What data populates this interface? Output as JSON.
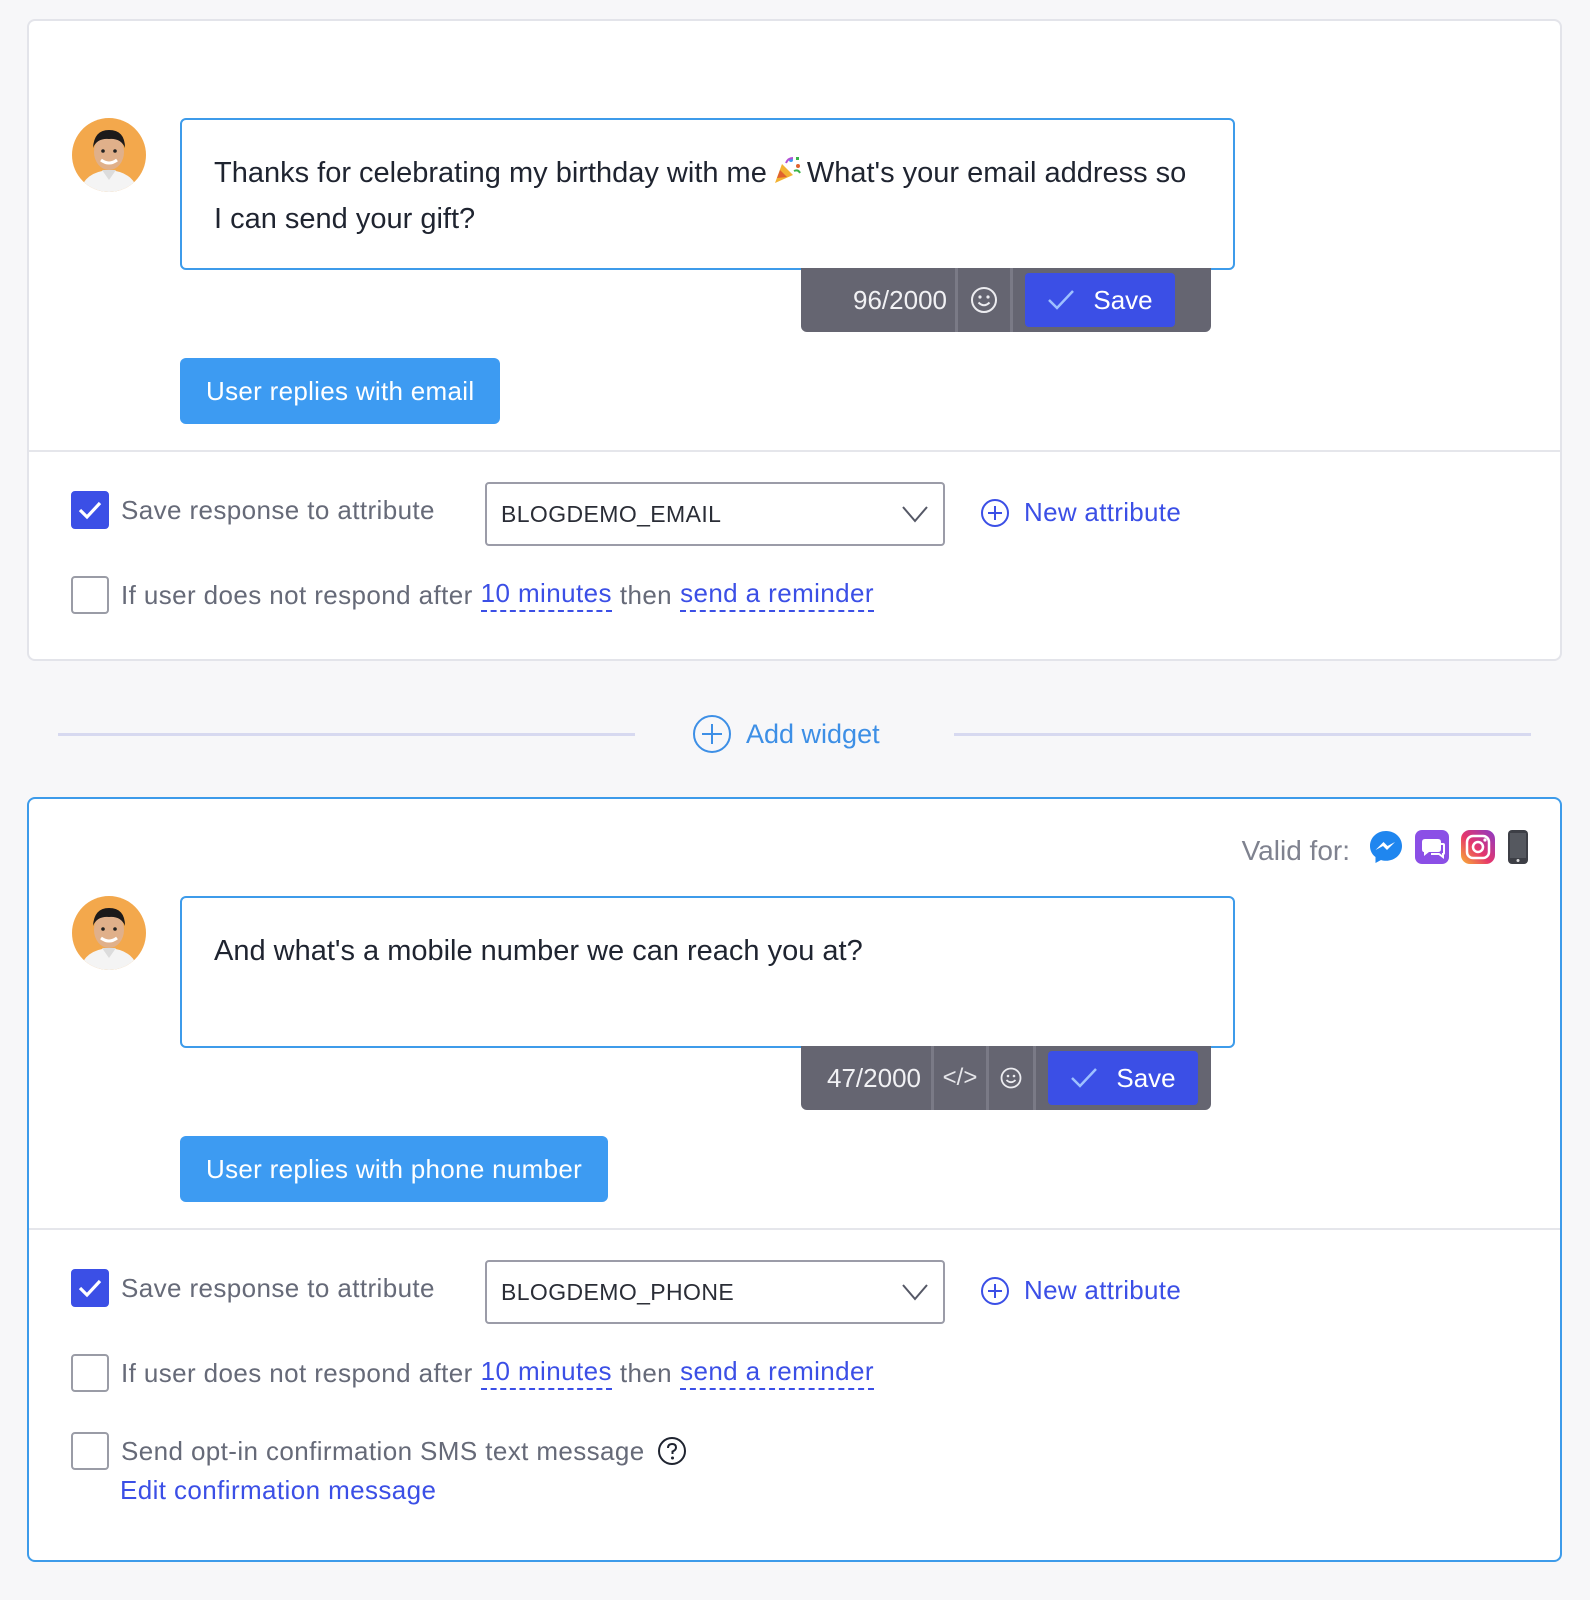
{
  "widget1": {
    "message": "Thanks for celebrating my birthday with me 🎉 What's your email address so I can send your gift?",
    "message_before_emoji": "Thanks for celebrating my birthday with me",
    "message_after_emoji": "What's your email address so I can send your gift?",
    "char_count": "96/2000",
    "save_label": "Save",
    "reply_button": "User replies with email",
    "save_response_label": "Save response to attribute",
    "save_response_checked": true,
    "attribute_value": "BLOGDEMO_EMAIL",
    "new_attribute_label": "New attribute",
    "reminder": {
      "checked": false,
      "prefix": "If user does not respond after",
      "delay": "10 minutes",
      "middle": "then",
      "action": "send a reminder"
    }
  },
  "add_widget_label": "Add widget",
  "widget2": {
    "valid_for_label": "Valid for:",
    "valid_for_icons": [
      "messenger-icon",
      "sms-chat-icon",
      "instagram-icon",
      "mobile-phone-icon"
    ],
    "message": "And what's a mobile number we can reach you at?",
    "char_count": "47/2000",
    "code_icon": "</>",
    "save_label": "Save",
    "reply_button": "User replies with phone number",
    "save_response_label": "Save response to attribute",
    "save_response_checked": true,
    "attribute_value": "BLOGDEMO_PHONE",
    "new_attribute_label": "New attribute",
    "reminder": {
      "checked": false,
      "prefix": "If user does not respond after",
      "delay": "10 minutes",
      "middle": "then",
      "action": "send a reminder"
    },
    "optin_label": "Send opt-in confirmation SMS text message",
    "optin_checked": false,
    "edit_confirmation_label": "Edit confirmation message"
  },
  "colors": {
    "primary": "#3b4fe6",
    "accent_blue": "#3d9bf2",
    "toolbar_bg": "#656571",
    "border_active": "#3d9bea"
  }
}
